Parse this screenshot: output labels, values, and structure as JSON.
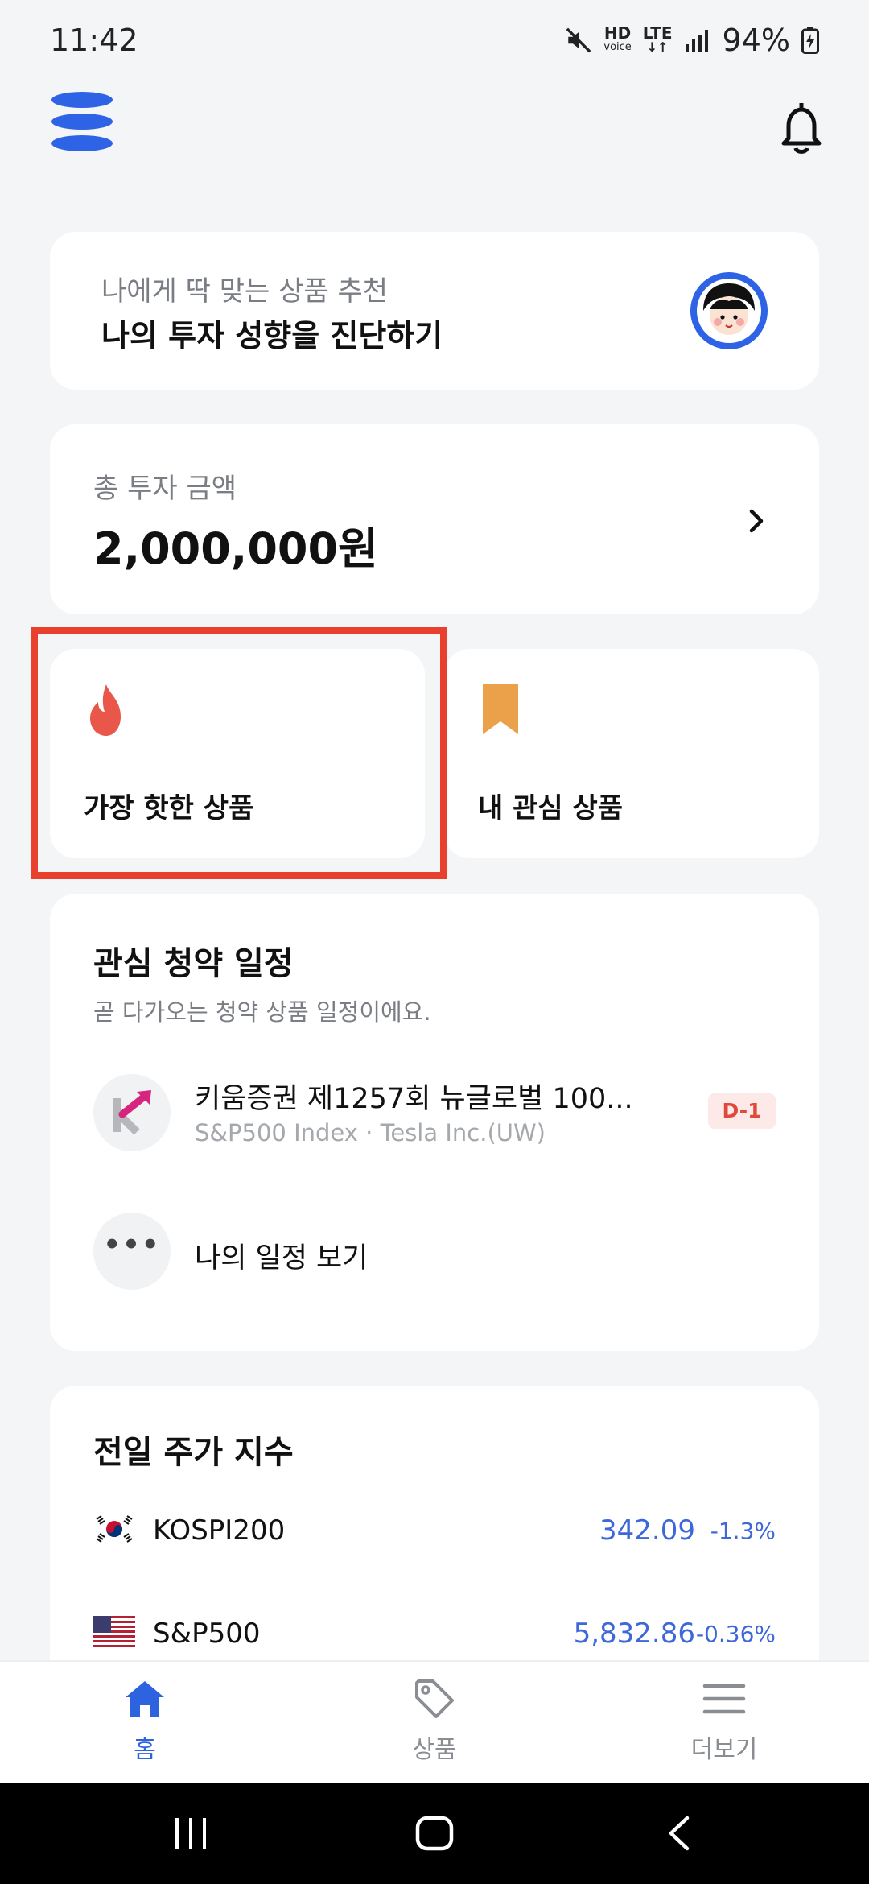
{
  "status_bar": {
    "time": "11:42",
    "hd_top": "HD",
    "hd_bottom": "voice",
    "network": "LTE",
    "battery": "94%"
  },
  "header": {
    "logo_icon": "brand-logo-icon",
    "notification_icon": "bell-icon"
  },
  "recommendation": {
    "subtitle": "나에게 딱 맞는 상품 추천",
    "title": "나의 투자 성향을 진단하기",
    "avatar_icon": "character-avatar-icon"
  },
  "total_investment": {
    "label": "총 투자 금액",
    "value": "2,000,000원"
  },
  "tiles": {
    "hot": {
      "label": "가장 핫한 상품",
      "icon": "fire-icon",
      "color": "#e8574a"
    },
    "favorites": {
      "label": "내 관심 상품",
      "icon": "bookmark-icon",
      "color": "#eba14a"
    }
  },
  "schedule": {
    "title": "관심 청약 일정",
    "subtitle": "곧 다가오는 청약 상품 일정이에요.",
    "item": {
      "title": "키움증권 제1257회 뉴글로벌 100...",
      "subtitle": "S&P500 Index · Tesla Inc.(UW)",
      "badge": "D-1"
    },
    "more_symbol": "•••",
    "my_schedule_label": "나의 일정 보기"
  },
  "indices": {
    "title": "전일 주가 지수",
    "rows": [
      {
        "name": "KOSPI200",
        "value": "342.09",
        "change": "-1.3%",
        "flag": "korea-flag-icon"
      },
      {
        "name": "S&P500",
        "value": "5,832.86",
        "change": "-0.36%",
        "flag": "us-flag-icon"
      }
    ]
  },
  "bottom_nav": {
    "home": "홈",
    "products": "상품",
    "more": "더보기",
    "active_color": "#2e63e0"
  },
  "colors": {
    "accent_blue": "#2e63e0",
    "highlight_red": "#e8402d",
    "background": "#f4f5f7"
  }
}
